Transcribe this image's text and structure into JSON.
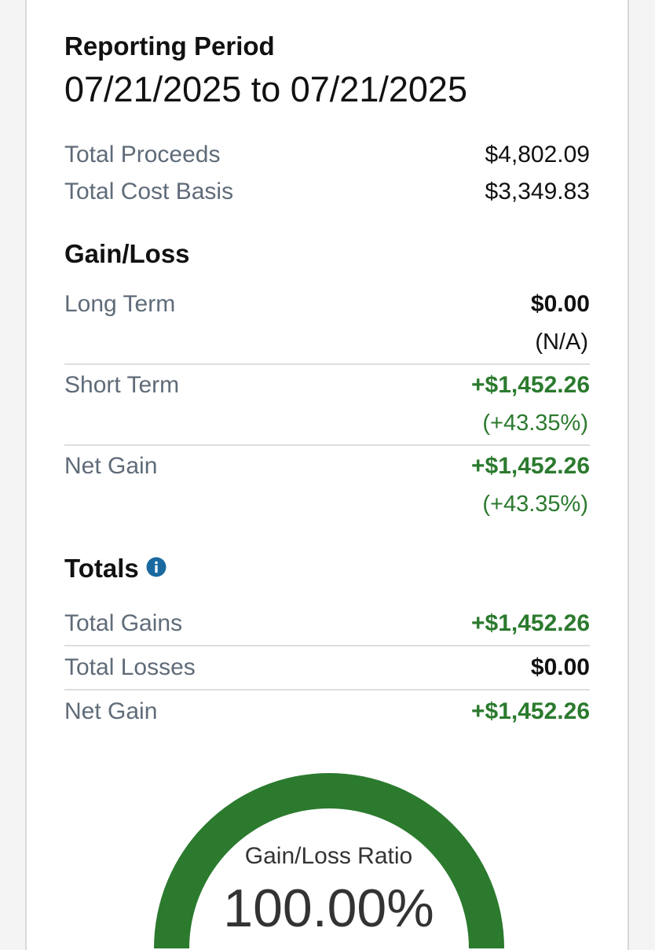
{
  "reporting": {
    "label": "Reporting Period",
    "range": "07/21/2025 to 07/21/2025"
  },
  "summary": {
    "proceeds_label": "Total Proceeds",
    "proceeds_value": "$4,802.09",
    "cost_basis_label": "Total Cost Basis",
    "cost_basis_value": "$3,349.83"
  },
  "gain_loss": {
    "title": "Gain/Loss",
    "long_term": {
      "label": "Long Term",
      "value": "$0.00",
      "sub": "(N/A)"
    },
    "short_term": {
      "label": "Short Term",
      "value": "+$1,452.26",
      "sub": "(+43.35%)"
    },
    "net_gain": {
      "label": "Net Gain",
      "value": "+$1,452.26",
      "sub": "(+43.35%)"
    }
  },
  "totals": {
    "title": "Totals",
    "info_icon": "info-icon",
    "total_gains": {
      "label": "Total Gains",
      "value": "+$1,452.26"
    },
    "total_losses": {
      "label": "Total Losses",
      "value": "$0.00"
    },
    "net_gain": {
      "label": "Net Gain",
      "value": "+$1,452.26"
    }
  },
  "gauge": {
    "label": "Gain/Loss Ratio",
    "value": "100.00%",
    "ratio": 1.0,
    "fill_color": "#2b7a2e"
  },
  "colors": {
    "positive": "#2b7a2e",
    "label": "#5f6b78",
    "info": "#1a6aa0"
  }
}
